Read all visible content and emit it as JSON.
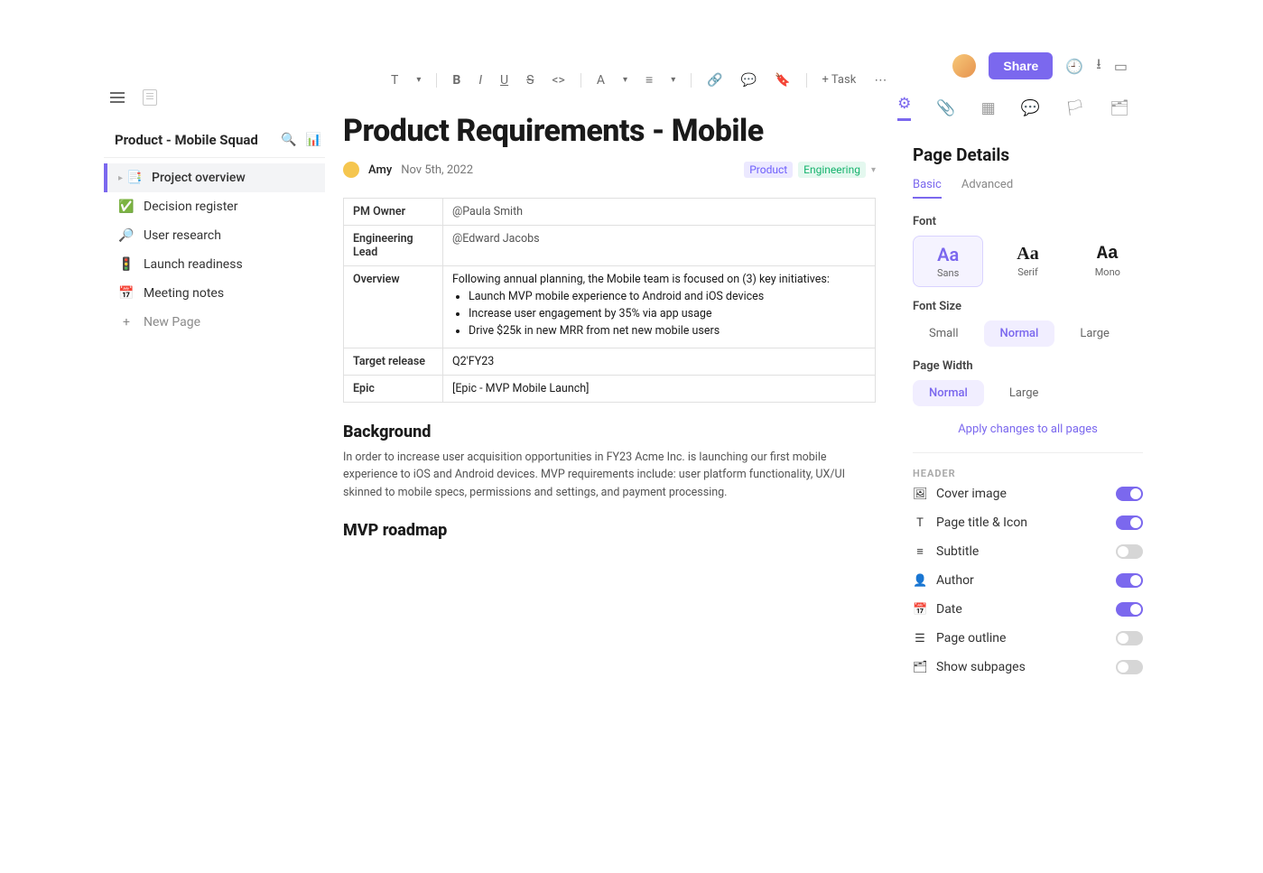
{
  "sidebar": {
    "title": "Product - Mobile Squad",
    "items": [
      {
        "emoji": "📑",
        "label": "Project overview",
        "active": true
      },
      {
        "emoji": "✅",
        "label": "Decision register"
      },
      {
        "emoji": "🔎",
        "label": "User research"
      },
      {
        "emoji": "🚦",
        "label": "Launch readiness"
      },
      {
        "emoji": "📅",
        "label": "Meeting notes"
      }
    ],
    "new_page": "New Page"
  },
  "toolbar": {
    "task_label": "+ Task",
    "font_size_label": "T",
    "more": "⋯"
  },
  "doc": {
    "title": "Product Requirements - Mobile",
    "author": "Amy",
    "date": "Nov 5th, 2022",
    "tags": {
      "product": "Product",
      "engineering": "Engineering"
    },
    "table": {
      "pm_owner_label": "PM Owner",
      "pm_owner_value": "@Paula Smith",
      "eng_lead_label": "Engineering Lead",
      "eng_lead_value": "@Edward Jacobs",
      "overview_label": "Overview",
      "overview_intro": "Following annual planning, the Mobile team is focused on (3) key initiatives:",
      "overview_items": [
        "Launch MVP mobile experience to Android and iOS devices",
        "Increase user engagement by 35% via app usage",
        "Drive $25k in new MRR from net new mobile users"
      ],
      "target_label": "Target release",
      "target_value": "Q2'FY23",
      "epic_label": "Epic",
      "epic_value": "[Epic - MVP Mobile Launch]"
    },
    "background_heading": "Background",
    "background_body": "In order to increase user acquisition opportunities in FY23 Acme Inc. is launching our first mobile experience to iOS and Android devices. MVP requirements include: user platform functionality, UX/UI skinned to mobile specs, permissions and settings, and payment processing.",
    "roadmap_heading": "MVP roadmap"
  },
  "header": {
    "share": "Share"
  },
  "panel": {
    "title": "Page Details",
    "subtabs": {
      "basic": "Basic",
      "advanced": "Advanced"
    },
    "font_label": "Font",
    "fonts": {
      "sans": "Sans",
      "serif": "Serif",
      "mono": "Mono",
      "sample": "Aa"
    },
    "font_size_label": "Font Size",
    "sizes": {
      "small": "Small",
      "normal": "Normal",
      "large": "Large"
    },
    "width_label": "Page Width",
    "widths": {
      "normal": "Normal",
      "large": "Large"
    },
    "apply": "Apply changes to all pages",
    "header_section": "HEADER",
    "toggles": {
      "cover": "Cover image",
      "title": "Page title & Icon",
      "subtitle": "Subtitle",
      "author": "Author",
      "date": "Date",
      "outline": "Page outline",
      "subpages": "Show subpages"
    }
  }
}
